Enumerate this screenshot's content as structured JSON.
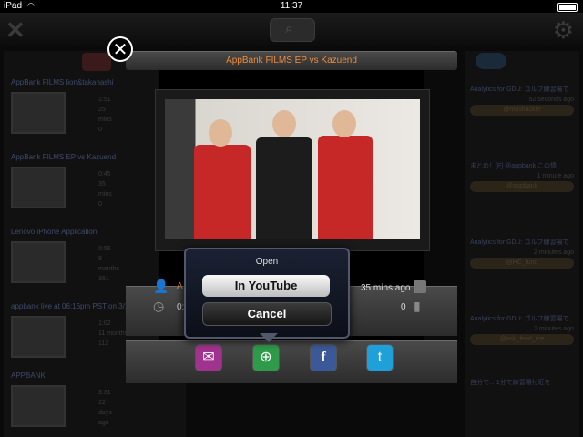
{
  "statusbar": {
    "carrier": "iPad",
    "time": "11:37"
  },
  "modal": {
    "title": "AppBank FILMS EP vs Kazuend",
    "time_ago": "35 mins ago",
    "author_initial": "A",
    "duration_partial": "0:4",
    "view_count": "0"
  },
  "dialog": {
    "title": "Open",
    "youtube_label": "In YouTube",
    "cancel_label": "Cancel"
  },
  "share": {
    "mail_icon": "mail-icon",
    "web_icon": "globe-icon",
    "facebook_icon": "facebook-icon",
    "twitter_icon": "twitter-icon"
  },
  "colors": {
    "accent": "#f08a3c",
    "mail": "#a0338e",
    "web": "#2f9a4a",
    "facebook": "#3b5998",
    "twitter": "#1fa0d8"
  },
  "background_feed": {
    "videos": [
      {
        "title": "AppBank FILMS lion&takahashi",
        "duration": "1:51",
        "age": "25 mins",
        "views": "0"
      },
      {
        "title": "AppBank FILMS EP vs Kazuend",
        "duration": "0:45",
        "age": "35 mins",
        "views": "0"
      },
      {
        "title": "Lenovo iPhone Application",
        "duration": "0:56",
        "age": "9 months",
        "views": "361"
      },
      {
        "title": "appbank live at 06:16pm PST on 3/1",
        "duration": "1:02",
        "age": "11 months",
        "views": "112"
      },
      {
        "title": "APPBANK",
        "duration": "3:31",
        "age": "22 days ago",
        "views": ""
      }
    ],
    "tweets": [
      {
        "text": "Analytics for GDU: ゴルフ練習場で",
        "age": "52 seconds ago",
        "handle": "@moshacker"
      },
      {
        "text": "まとめ！[F] @appbank この情",
        "age": "1 minute ago",
        "handle": "@appbank"
      },
      {
        "text": "Analytics for GDU: ゴルフ練習場で",
        "age": "2 minutes ago",
        "handle": "@HC_fund"
      },
      {
        "text": "Analytics for GDU: ゴルフ練習場で",
        "age": "2 minutes ago",
        "handle": "@ask_feed_me"
      },
      {
        "text": "自分で... 1分で練習場付近を",
        "age": "",
        "handle": ""
      }
    ]
  }
}
